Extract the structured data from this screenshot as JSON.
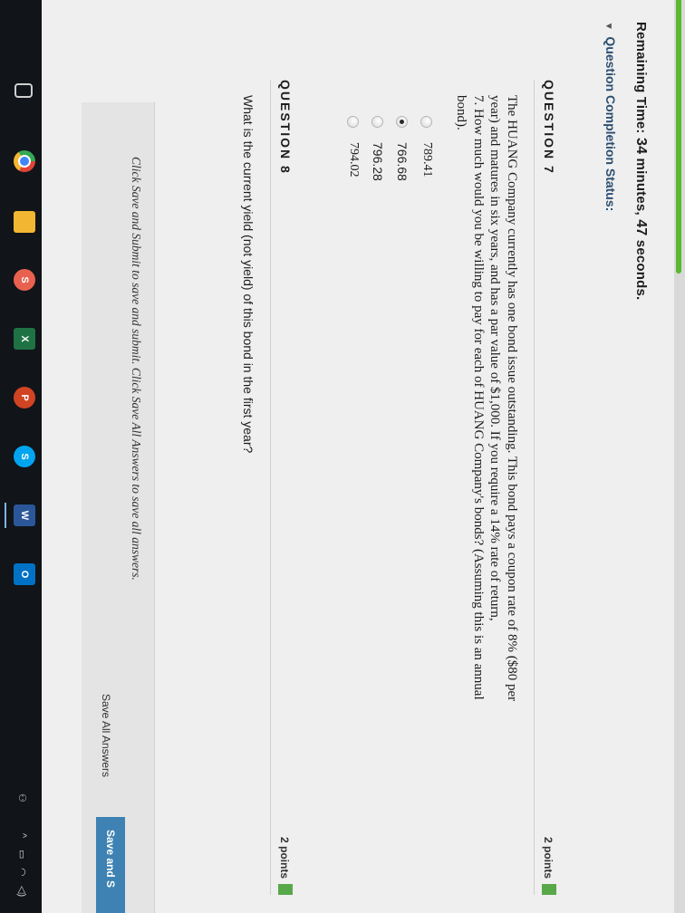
{
  "header": {
    "remaining_label": "Remaining Time:",
    "minutes_value": "34",
    "minutes_label": "minutes,",
    "seconds_value": "47",
    "seconds_label": "seconds.",
    "completion_label": "Question Completion Status:",
    "progress_fraction": 0.3
  },
  "question7": {
    "title": "QUESTION 7",
    "points": "2 points",
    "text_lines": [
      "The HUANG Company currently has one bond issue outstanding. This bond pays a coupon rate of 8% ($80 per",
      "year) and matures in six years, and has a par value of $1,000. If you require a 14% rate of return,",
      "7. How much would you be willing to pay for each of HUANG Company's bonds? (Assuming this is an annual",
      "bond)."
    ],
    "options": [
      {
        "label": "789.41",
        "selected": false
      },
      {
        "label": "766.68",
        "selected": true
      },
      {
        "label": "796.28",
        "selected": false
      },
      {
        "label": "794.02",
        "selected": false
      }
    ]
  },
  "question8": {
    "title": "QUESTION 8",
    "points": "2 points",
    "text": "What is the current yield (not yield) of this bond in the first year?"
  },
  "footer": {
    "note": "Click Save and Submit to save and submit. Click Save All Answers to save all answers.",
    "save_all_label": "Save All Answers",
    "save_submit_label": "Save and S"
  },
  "taskbar": {
    "icons": [
      {
        "name": "chrome-icon",
        "glyph": "",
        "color": "#e14236"
      },
      {
        "name": "file-explorer-icon",
        "glyph": "",
        "color": "#f2b632"
      },
      {
        "name": "swirl-app-icon",
        "glyph": "S",
        "color": "#e8614f"
      },
      {
        "name": "excel-icon",
        "glyph": "X",
        "color": "#1f7244"
      },
      {
        "name": "powerpoint-icon",
        "glyph": "P",
        "color": "#d04423"
      },
      {
        "name": "skype-icon",
        "glyph": "S",
        "color": "#00a4ef"
      },
      {
        "name": "word-icon",
        "glyph": "W",
        "color": "#2b579a"
      },
      {
        "name": "outlook-icon",
        "glyph": "O",
        "color": "#0072c6"
      }
    ]
  }
}
